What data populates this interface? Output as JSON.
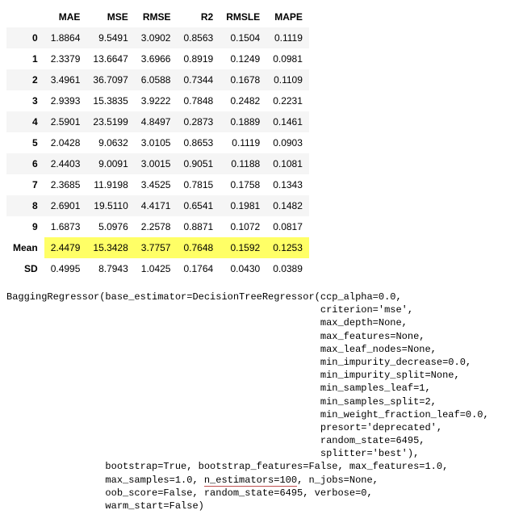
{
  "table": {
    "headers": [
      "",
      "MAE",
      "MSE",
      "RMSE",
      "R2",
      "RMSLE",
      "MAPE"
    ],
    "rows": [
      {
        "label": "0",
        "cells": [
          "1.8864",
          "9.5491",
          "3.0902",
          "0.8563",
          "0.1504",
          "0.1119"
        ],
        "highlight": false
      },
      {
        "label": "1",
        "cells": [
          "2.3379",
          "13.6647",
          "3.6966",
          "0.8919",
          "0.1249",
          "0.0981"
        ],
        "highlight": false
      },
      {
        "label": "2",
        "cells": [
          "3.4961",
          "36.7097",
          "6.0588",
          "0.7344",
          "0.1678",
          "0.1109"
        ],
        "highlight": false
      },
      {
        "label": "3",
        "cells": [
          "2.9393",
          "15.3835",
          "3.9222",
          "0.7848",
          "0.2482",
          "0.2231"
        ],
        "highlight": false
      },
      {
        "label": "4",
        "cells": [
          "2.5901",
          "23.5199",
          "4.8497",
          "0.2873",
          "0.1889",
          "0.1461"
        ],
        "highlight": false
      },
      {
        "label": "5",
        "cells": [
          "2.0428",
          "9.0632",
          "3.0105",
          "0.8653",
          "0.1119",
          "0.0903"
        ],
        "highlight": false
      },
      {
        "label": "6",
        "cells": [
          "2.4403",
          "9.0091",
          "3.0015",
          "0.9051",
          "0.1188",
          "0.1081"
        ],
        "highlight": false
      },
      {
        "label": "7",
        "cells": [
          "2.3685",
          "11.9198",
          "3.4525",
          "0.7815",
          "0.1758",
          "0.1343"
        ],
        "highlight": false
      },
      {
        "label": "8",
        "cells": [
          "2.6901",
          "19.5110",
          "4.4171",
          "0.6541",
          "0.1981",
          "0.1482"
        ],
        "highlight": false
      },
      {
        "label": "9",
        "cells": [
          "1.6873",
          "5.0976",
          "2.2578",
          "0.8871",
          "0.1072",
          "0.0817"
        ],
        "highlight": false
      },
      {
        "label": "Mean",
        "cells": [
          "2.4479",
          "15.3428",
          "3.7757",
          "0.7648",
          "0.1592",
          "0.1253"
        ],
        "highlight": true
      },
      {
        "label": "SD",
        "cells": [
          "0.4995",
          "8.7943",
          "1.0425",
          "0.1764",
          "0.0430",
          "0.0389"
        ],
        "highlight": false
      }
    ]
  },
  "model_repr": {
    "lines": [
      "BaggingRegressor(base_estimator=DecisionTreeRegressor(ccp_alpha=0.0,",
      "                                                      criterion='mse',",
      "                                                      max_depth=None,",
      "                                                      max_features=None,",
      "                                                      max_leaf_nodes=None,",
      "                                                      min_impurity_decrease=0.0,",
      "                                                      min_impurity_split=None,",
      "                                                      min_samples_leaf=1,",
      "                                                      min_samples_split=2,",
      "                                                      min_weight_fraction_leaf=0.0,",
      "                                                      presort='deprecated',",
      "                                                      random_state=6495,",
      "                                                      splitter='best'),",
      "                 bootstrap=True, bootstrap_features=False, max_features=1.0,",
      "                 max_samples=1.0, {UNDER}n_estimators=100{/UNDER}, n_jobs=None,",
      "                 oob_score=False, random_state=6495, verbose=0,",
      "                 warm_start=False)"
    ]
  }
}
